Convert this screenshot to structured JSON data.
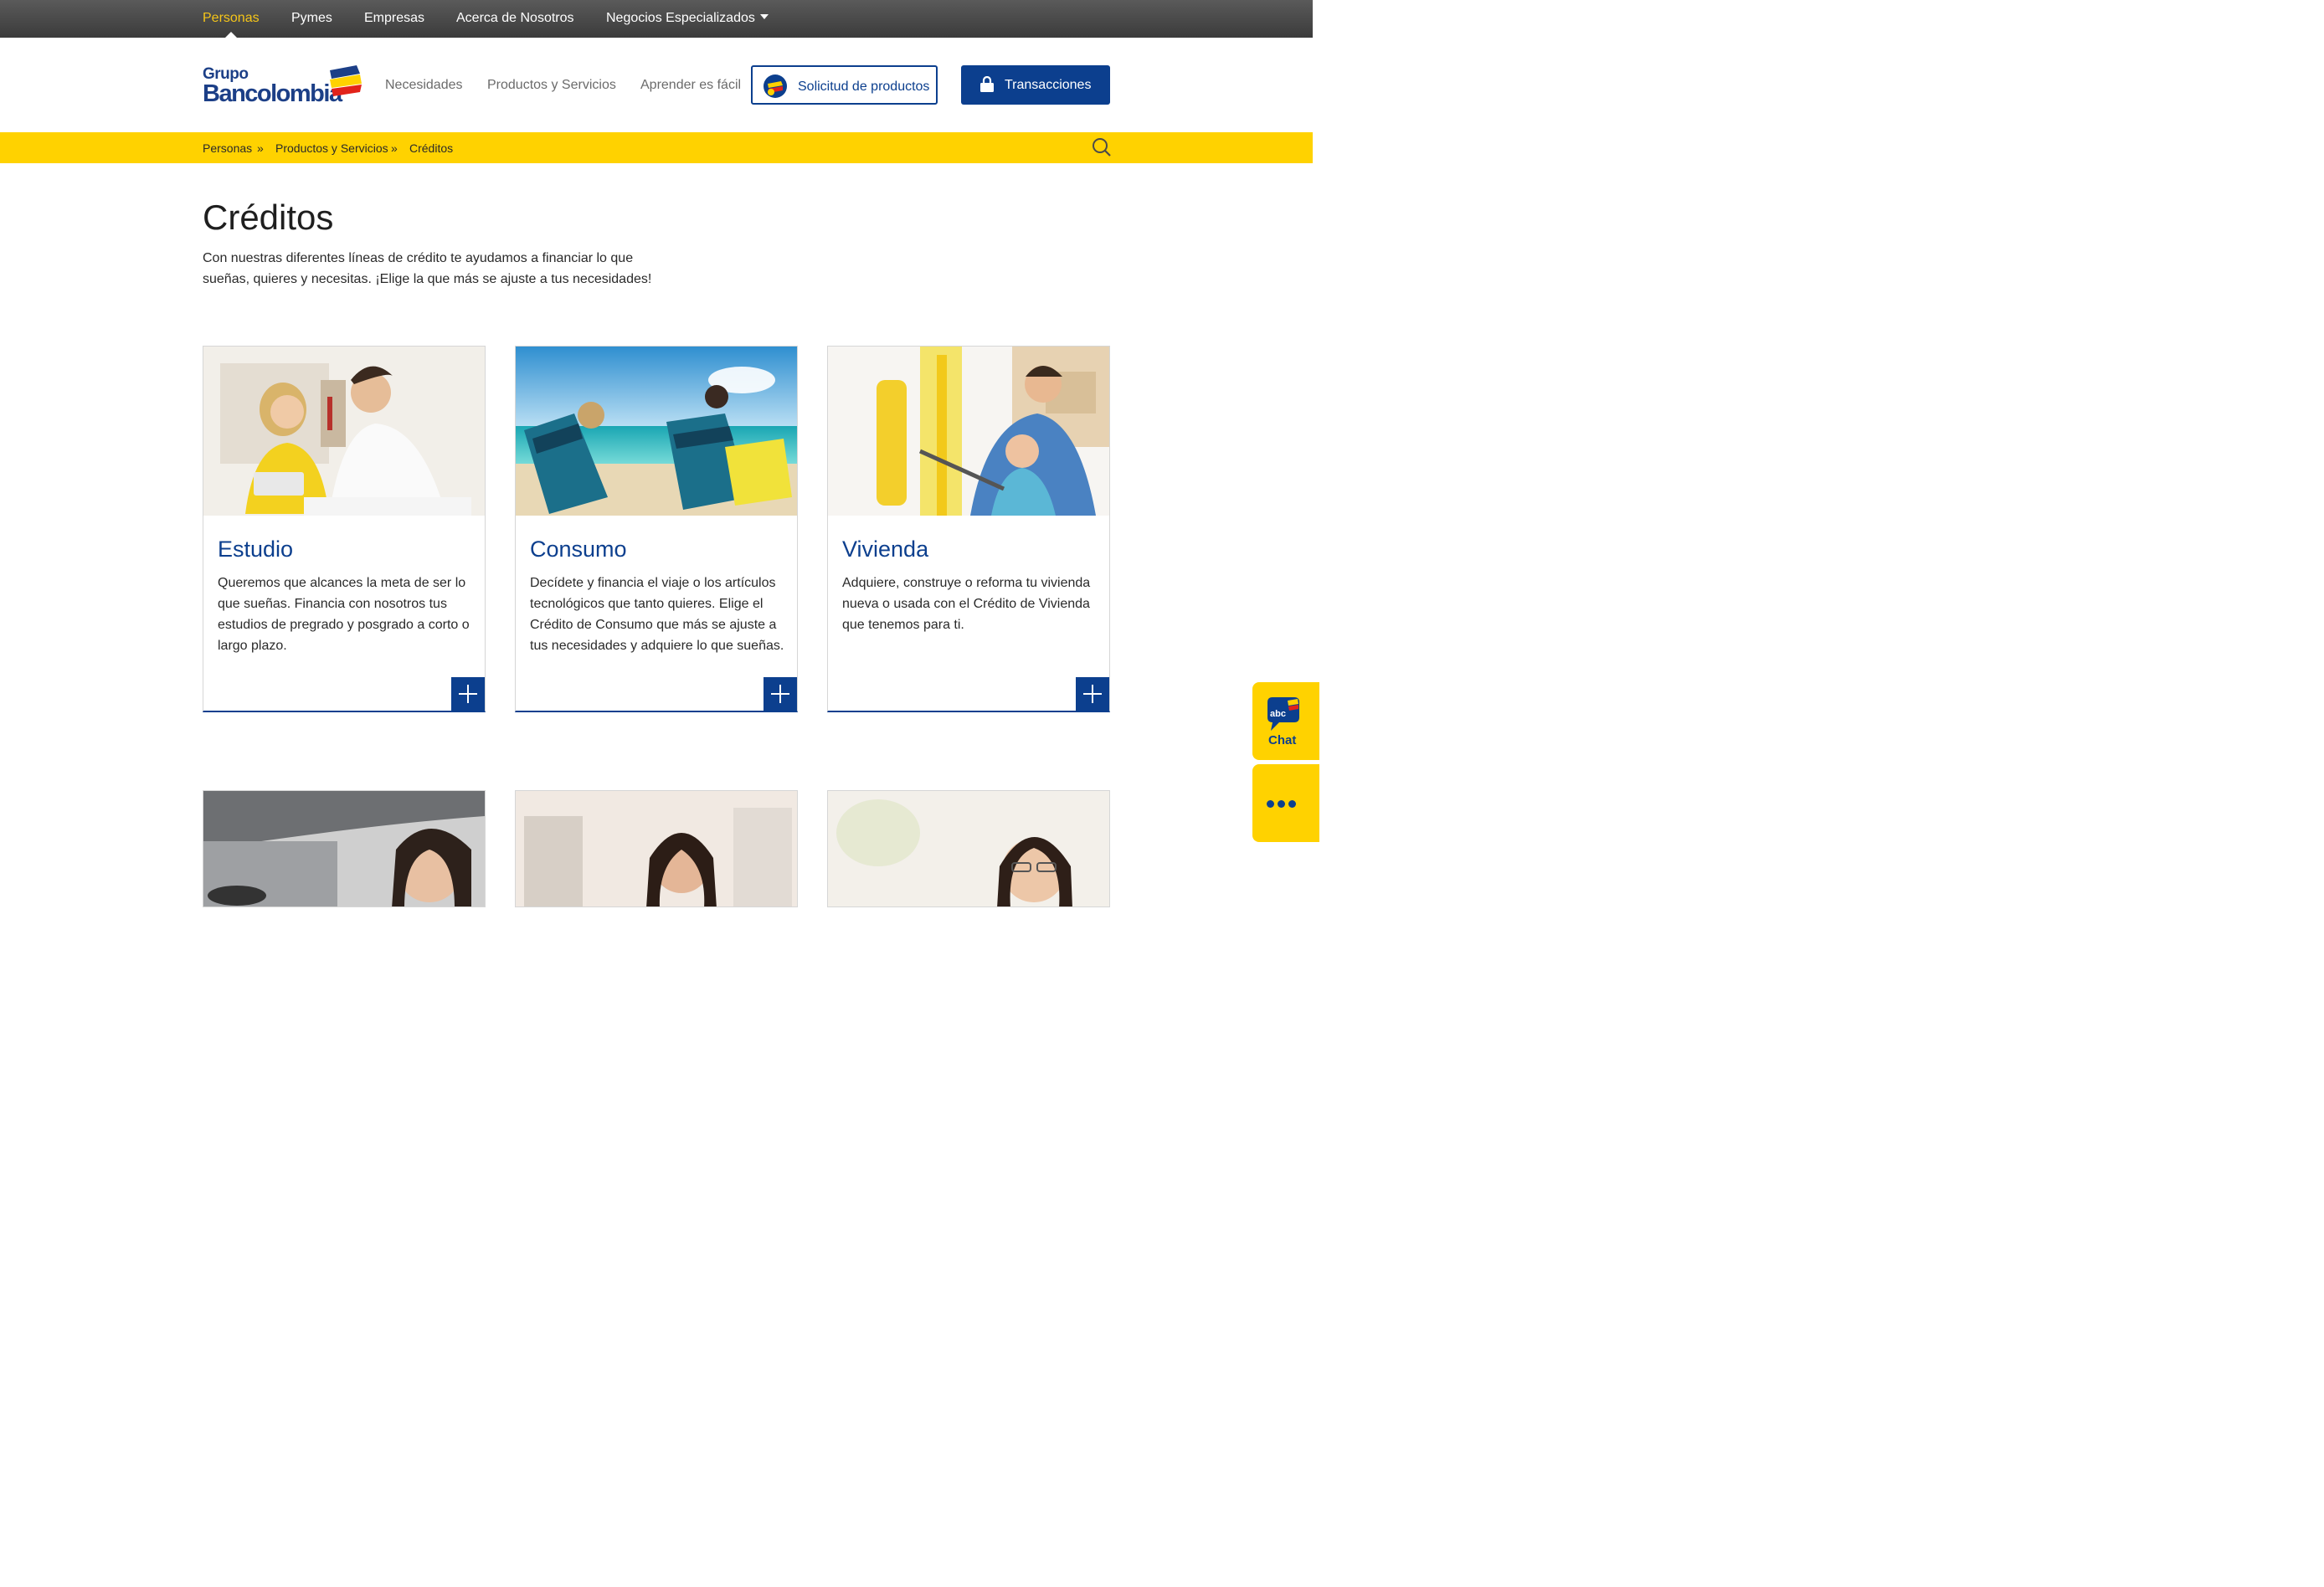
{
  "top_nav": {
    "items": [
      {
        "label": "Personas",
        "active": true
      },
      {
        "label": "Pymes",
        "active": false
      },
      {
        "label": "Empresas",
        "active": false
      },
      {
        "label": "Acerca de Nosotros",
        "active": false
      },
      {
        "label": "Negocios Especializados",
        "active": false,
        "has_dropdown": true
      }
    ]
  },
  "header": {
    "logo_line1": "Grupo",
    "logo_line2": "Bancolombia",
    "nav": [
      "Necesidades",
      "Productos y Servicios",
      "Aprender es fácil"
    ],
    "solicitud_button": "Solicitud de productos",
    "transacciones_button": "Transacciones"
  },
  "breadcrumb": {
    "items": [
      "Personas",
      "Productos y Servicios",
      "Créditos"
    ],
    "separator": "»"
  },
  "page": {
    "title": "Créditos",
    "intro": "Con nuestras diferentes líneas de crédito te ayudamos a financiar lo que sueñas, quieres y necesitas. ¡Elige la que más se ajuste a tus necesidades!"
  },
  "cards": [
    {
      "title": "Estudio",
      "description": "Queremos que alcances la meta de ser lo que sueñas. Financia con nosotros tus estudios de pregrado y posgrado a corto o largo plazo.",
      "image": "couple-studying-photo"
    },
    {
      "title": "Consumo",
      "description": "Decídete y financia el viaje o los artículos tecnológicos que tanto quieres. Elige el Crédito de Consumo que más se ajuste a tus necesidades y adquiere lo que sueñas.",
      "image": "beach-chairs-photo"
    },
    {
      "title": "Vivienda",
      "description": "Adquiere, construye o reforma tu vivienda nueva o usada con el Crédito de Vivienda que tenemos para ti.",
      "image": "family-painting-photo"
    }
  ],
  "lower_cards": [
    "woman-driving-photo",
    "woman-shop-photo",
    "woman-glasses-photo"
  ],
  "side_widgets": {
    "chat_label": "Chat",
    "chat_icon_text": "abc"
  },
  "colors": {
    "brand_blue": "#0c3f8e",
    "brand_yellow": "#ffd200",
    "active_nav": "#f5c518"
  }
}
